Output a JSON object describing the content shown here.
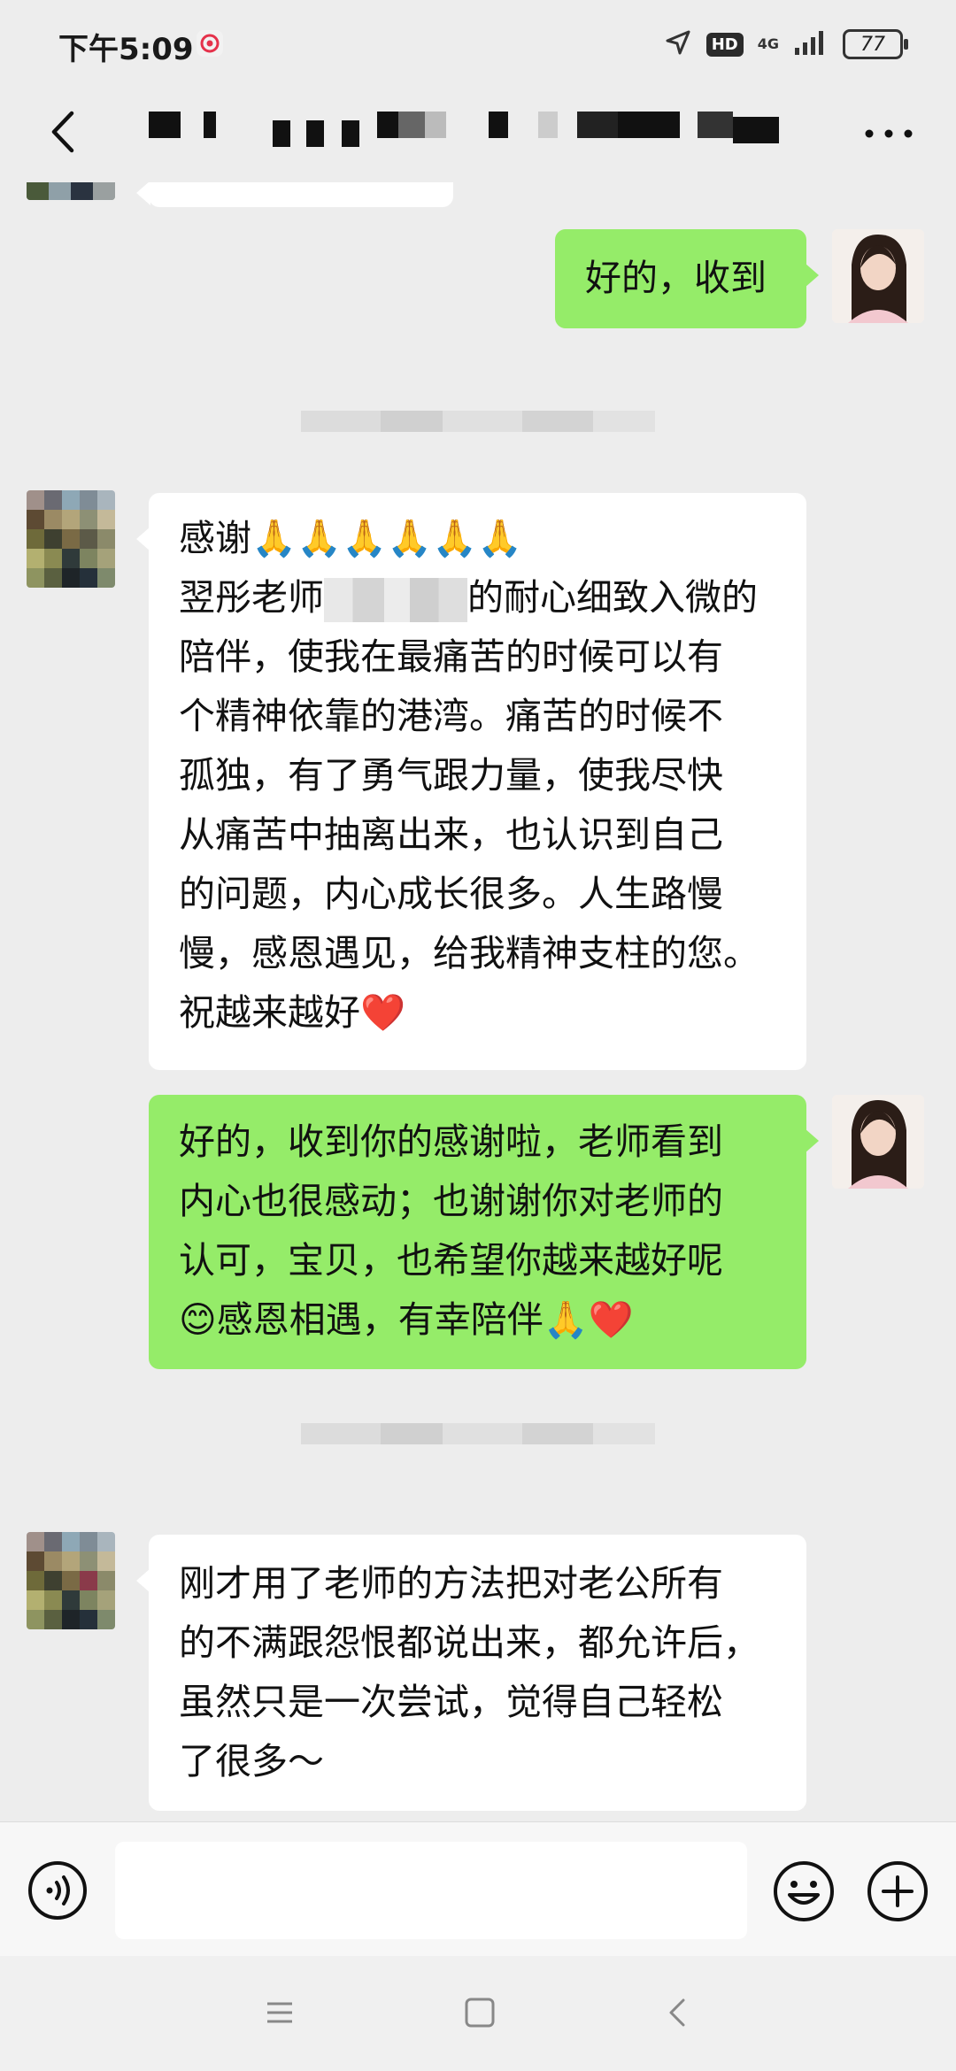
{
  "status_bar": {
    "time": "下午5:09",
    "hd_label": "HD",
    "network_label": "4G",
    "battery_level": "77"
  },
  "header": {
    "icons": {
      "back": "chevron-left-icon",
      "more": "more-dots-icon"
    }
  },
  "messages": [
    {
      "side": "right",
      "lines": [
        "好的，收到"
      ]
    },
    {
      "side": "left",
      "lines": [
        "感谢🙏🙏🙏🙏🙏🙏",
        "翌彤老师",
        "的耐心细致入微的",
        "陪伴，使我在最痛苦的时候可以有",
        "个精神依靠的港湾。痛苦的时候不",
        "孤独，有了勇气跟力量，使我尽快",
        "从痛苦中抽离出来，也认识到自己",
        "的问题，内心成长很多。人生路慢",
        "慢，感恩遇见，给我精神支柱的您。",
        "祝越来越好❤️"
      ]
    },
    {
      "side": "right",
      "lines": [
        "好的，收到你的感谢啦，老师看到",
        "内心也很感动；也谢谢你对老师的",
        "认可，宝贝，也希望你越来越好呢",
        "😊感恩相遇，有幸陪伴🙏❤️"
      ]
    },
    {
      "side": "left",
      "lines": [
        "刚才用了老师的方法把对老公所有",
        "的不满跟怨恨都说出来，都允许后，",
        "虽然只是一次尝试，觉得自己轻松",
        "了很多～"
      ]
    }
  ],
  "input_bar": {
    "icons": {
      "voice": "voice-icon",
      "emoji": "emoji-icon",
      "plus": "plus-icon"
    },
    "text_value": ""
  },
  "nav_bar": {
    "icons": {
      "menu": "menu-icon",
      "home": "home-icon",
      "back": "back-triangle-icon"
    }
  }
}
